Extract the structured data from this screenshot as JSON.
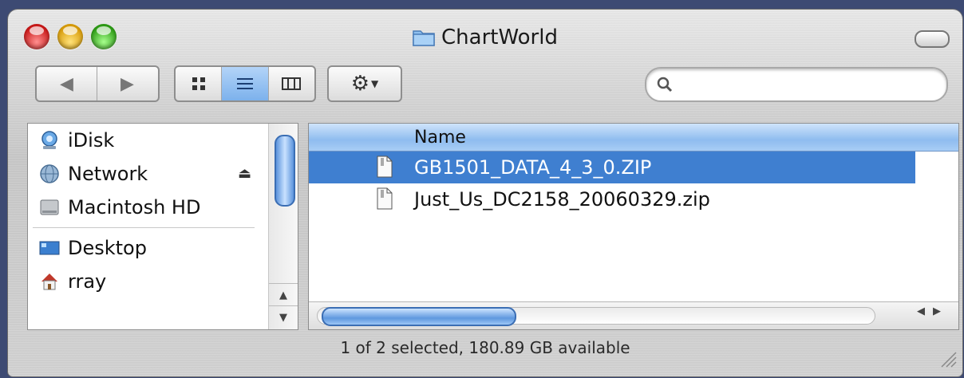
{
  "window": {
    "title": "ChartWorld",
    "title_icon": "folder-icon"
  },
  "toolbar": {
    "back_icon": "back-arrow-icon",
    "forward_icon": "forward-arrow-icon",
    "view_icons": [
      "icon-view-icon",
      "list-view-icon",
      "column-view-icon"
    ],
    "active_view": "list",
    "action_icon": "gear-icon",
    "search": {
      "value": "",
      "placeholder": ""
    }
  },
  "sidebar": {
    "devices": [
      {
        "label": "iDisk",
        "icon": "idisk-icon"
      },
      {
        "label": "Network",
        "icon": "network-icon",
        "eject": true
      },
      {
        "label": "Macintosh HD",
        "icon": "hard-drive-icon"
      }
    ],
    "places": [
      {
        "label": "Desktop",
        "icon": "desktop-icon"
      },
      {
        "label": "rray",
        "icon": "home-icon"
      }
    ]
  },
  "file_list": {
    "column_header": "Name",
    "rows": [
      {
        "name": "GB1501_DATA_4_3_0.ZIP",
        "selected": true,
        "icon": "document-icon"
      },
      {
        "name": "Just_Us_DC2158_20060329.zip",
        "selected": false,
        "icon": "document-icon"
      }
    ]
  },
  "status_bar": {
    "text": "1 of 2 selected, 180.89 GB available"
  },
  "colors": {
    "selection": "#3f7fd0",
    "header_blue": "#8fbcef",
    "close": "#c81818",
    "minimize": "#d79b08",
    "zoom": "#2c9a14"
  }
}
